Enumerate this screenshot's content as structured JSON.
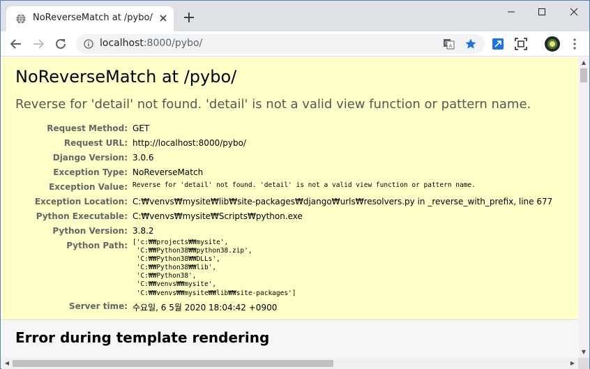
{
  "browser": {
    "tab_title": "NoReverseMatch at /pybo/",
    "url_host": "localhost",
    "url_rest": ":8000/pybo/",
    "icons": [
      "globe-icon",
      "close-icon",
      "plus-icon",
      "minimize-icon",
      "maximize-icon",
      "close-window-icon",
      "back-icon",
      "forward-icon",
      "reload-icon",
      "info-icon",
      "translate-icon",
      "star-icon",
      "extension-icon",
      "screenshot-icon",
      "avatar",
      "menu-icon"
    ],
    "accent_color": "#1a73e8"
  },
  "error": {
    "title": "NoReverseMatch at /pybo/",
    "message": "Reverse for 'detail' not found. 'detail' is not a valid view function or pattern name.",
    "meta": [
      {
        "label": "Request Method:",
        "value": "GET"
      },
      {
        "label": "Request URL:",
        "value": "http://localhost:8000/pybo/"
      },
      {
        "label": "Django Version:",
        "value": "3.0.6"
      },
      {
        "label": "Exception Type:",
        "value": "NoReverseMatch"
      },
      {
        "label": "Exception Value:",
        "value": "Reverse for 'detail' not found. 'detail' is not a valid view function or pattern name."
      },
      {
        "label": "Exception Location:",
        "value": "C:₩venvs₩mysite₩lib₩site-packages₩django₩urls₩resolvers.py in _reverse_with_prefix, line 677"
      },
      {
        "label": "Python Executable:",
        "value": "C:₩venvs₩mysite₩Scripts₩python.exe"
      },
      {
        "label": "Python Version:",
        "value": "3.8.2"
      },
      {
        "label": "Python Path:",
        "value": "['c:₩₩projects₩₩mysite',\n 'C:₩₩Python38₩₩python38.zip',\n 'C:₩₩Python38₩₩DLLs',\n 'C:₩₩Python38₩₩lib',\n 'C:₩₩Python38',\n 'C:₩₩venvs₩₩mysite',\n 'C:₩₩venvs₩₩mysite₩₩lib₩₩site-packages']"
      },
      {
        "label": "Server time:",
        "value": "수요일, 6 5월 2020 18:04:42 +0900"
      }
    ],
    "template_heading": "Error during template rendering"
  }
}
